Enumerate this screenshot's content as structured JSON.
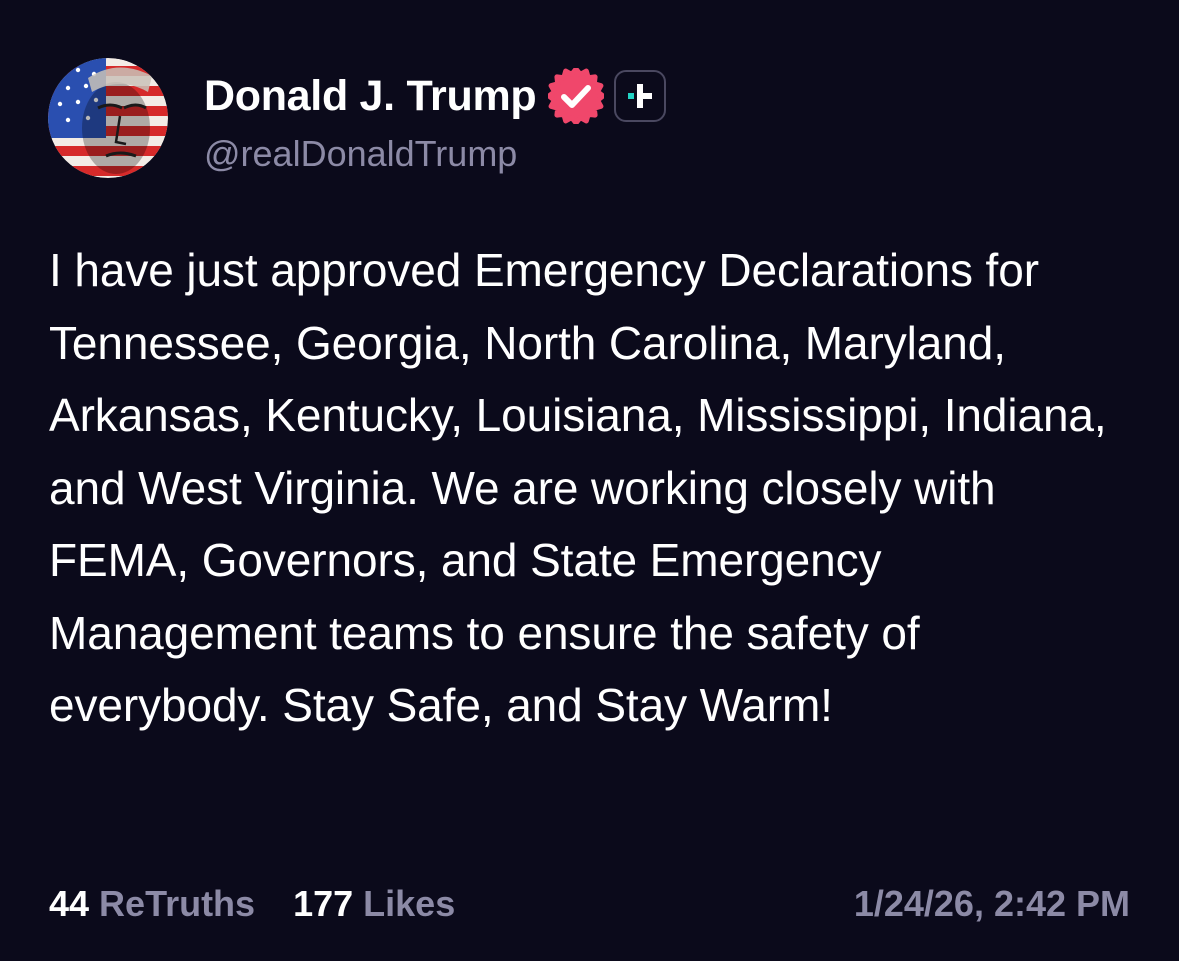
{
  "author": {
    "display_name": "Donald J. Trump",
    "handle": "@realDonaldTrump",
    "verified_icon": "verified-badge-icon",
    "follow_icon": "plus-icon"
  },
  "post": {
    "text": "I have just approved Emergency Declarations for Tennessee, Georgia, North Carolina, Maryland, Arkansas, Kentucky, Louisiana, Mississippi, Indiana, and West Virginia. We are working closely with FEMA, Governors, and State Emergency Management teams to ensure the safety of everybody. Stay Safe, and Stay Warm!"
  },
  "stats": {
    "retruths_count": "44",
    "retruths_label": "ReTruths",
    "likes_count": "177",
    "likes_label": "Likes"
  },
  "timestamp": "1/24/26, 2:42 PM",
  "colors": {
    "background": "#0b0a1b",
    "text": "#ffffff",
    "muted": "#8c8aa6",
    "verified_badge": "#f0476b",
    "accent_teal": "#22d3c5"
  }
}
